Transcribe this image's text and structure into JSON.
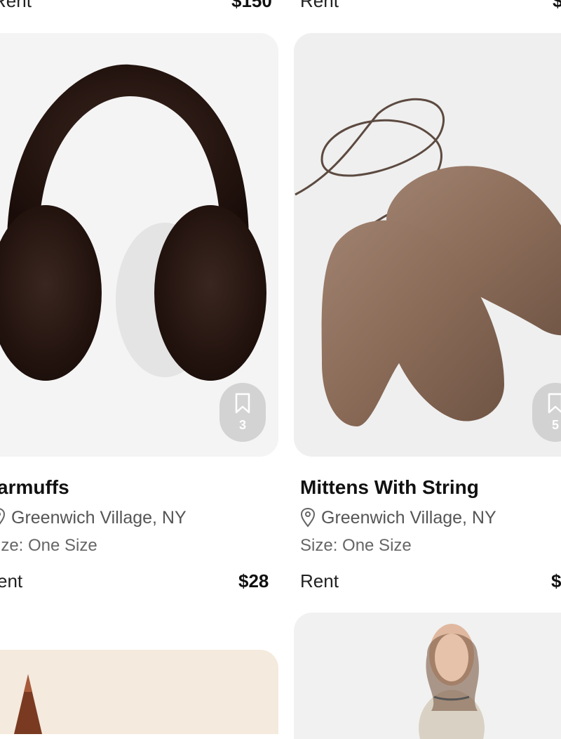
{
  "top_row": {
    "left_rent": "Rent",
    "left_price": "$150",
    "right_rent": "Rent",
    "right_price": "$"
  },
  "products": [
    {
      "title": "armuffs",
      "location": "Greenwich Village, NY",
      "size": "ize: One Size",
      "rent": "ent",
      "price": "$28",
      "bookmark_count": "3",
      "image_icon": "earmuffs-image"
    },
    {
      "title": "Mittens With String",
      "location": "Greenwich Village, NY",
      "size": "Size: One Size",
      "rent": "Rent",
      "price": "$",
      "bookmark_count": "5",
      "image_icon": "mittens-image"
    }
  ],
  "icons": {
    "bookmark": "bookmark-icon",
    "location": "location-pin-icon"
  }
}
